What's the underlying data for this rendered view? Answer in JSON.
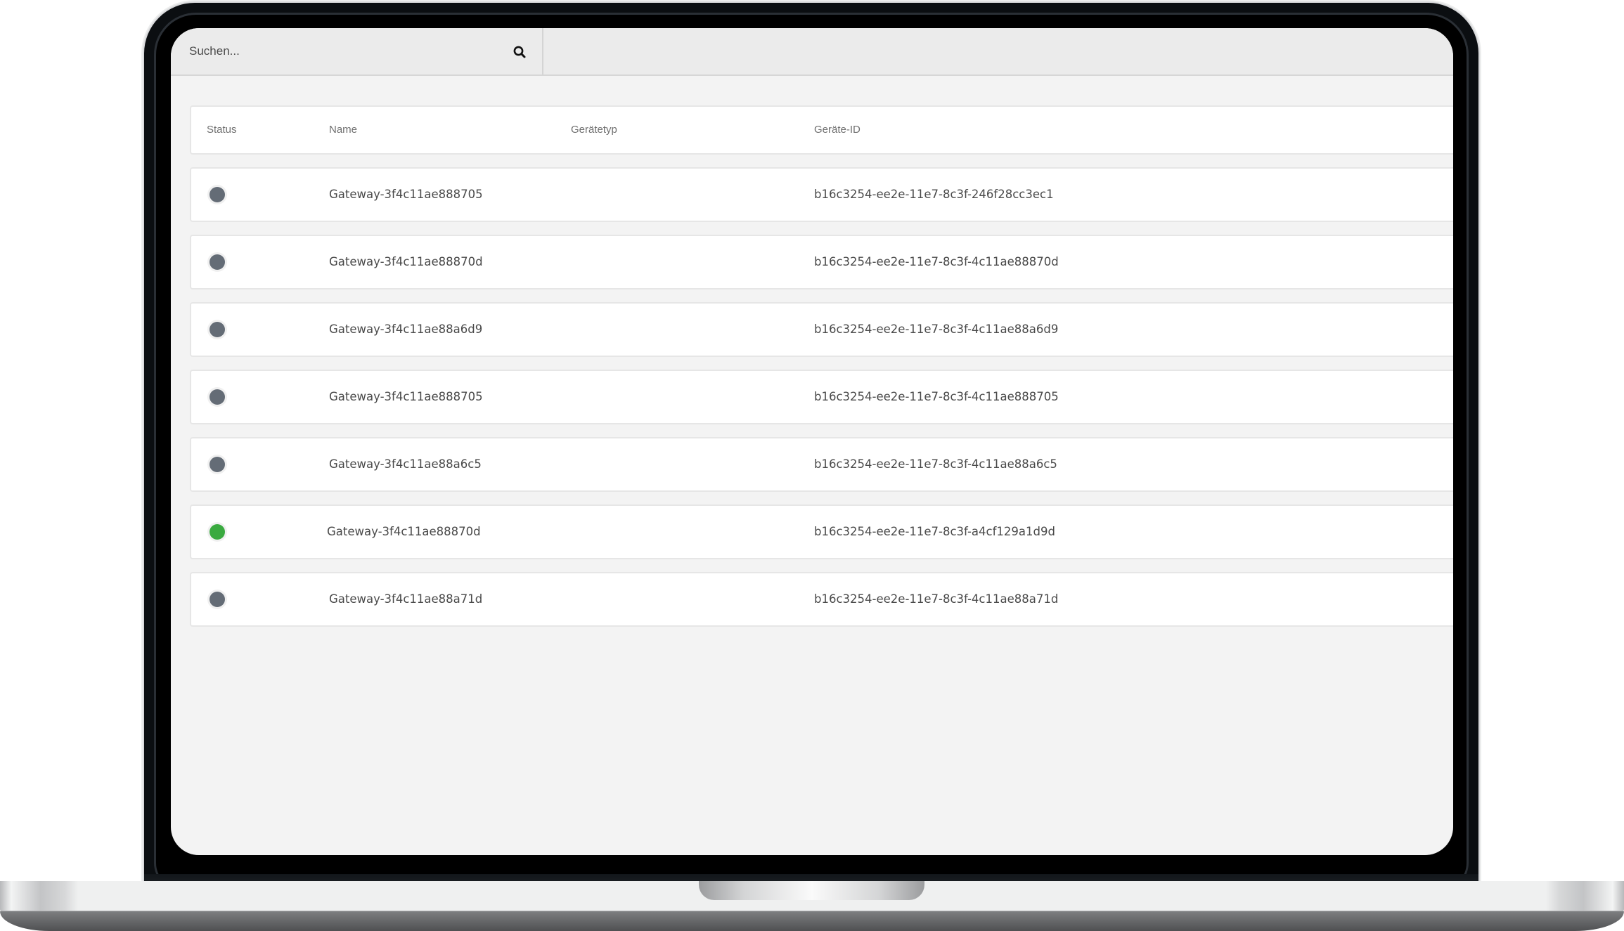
{
  "search": {
    "placeholder": "Suchen...",
    "value": "",
    "icon": "search-icon"
  },
  "table": {
    "columns": [
      {
        "key": "status",
        "label": "Status"
      },
      {
        "key": "name",
        "label": "Name"
      },
      {
        "key": "device_type",
        "label": "Gerätetyp"
      },
      {
        "key": "device_id",
        "label": "Geräte-ID"
      }
    ],
    "rows": [
      {
        "status": "offline",
        "name": "Gateway-3f4c11ae888705",
        "device_type": "",
        "device_id": "b16c3254-ee2e-11e7-8c3f-246f28cc3ec1"
      },
      {
        "status": "offline",
        "name": "Gateway-3f4c11ae88870d",
        "device_type": "",
        "device_id": "b16c3254-ee2e-11e7-8c3f-4c11ae88870d"
      },
      {
        "status": "offline",
        "name": "Gateway-3f4c11ae88a6d9",
        "device_type": "",
        "device_id": "b16c3254-ee2e-11e7-8c3f-4c11ae88a6d9"
      },
      {
        "status": "offline",
        "name": "Gateway-3f4c11ae888705",
        "device_type": "",
        "device_id": "b16c3254-ee2e-11e7-8c3f-4c11ae888705"
      },
      {
        "status": "offline",
        "name": "Gateway-3f4c11ae88a6c5",
        "device_type": "",
        "device_id": "b16c3254-ee2e-11e7-8c3f-4c11ae88a6c5"
      },
      {
        "status": "online",
        "name": "Gateway-3f4c11ae88870d",
        "device_type": "",
        "device_id": "b16c3254-ee2e-11e7-8c3f-a4cf129a1d9d"
      },
      {
        "status": "offline",
        "name": "Gateway-3f4c11ae88a71d",
        "device_type": "",
        "device_id": "b16c3254-ee2e-11e7-8c3f-4c11ae88a71d"
      }
    ]
  },
  "status_colors": {
    "online": "#3aaa40",
    "offline": "#646c76"
  }
}
